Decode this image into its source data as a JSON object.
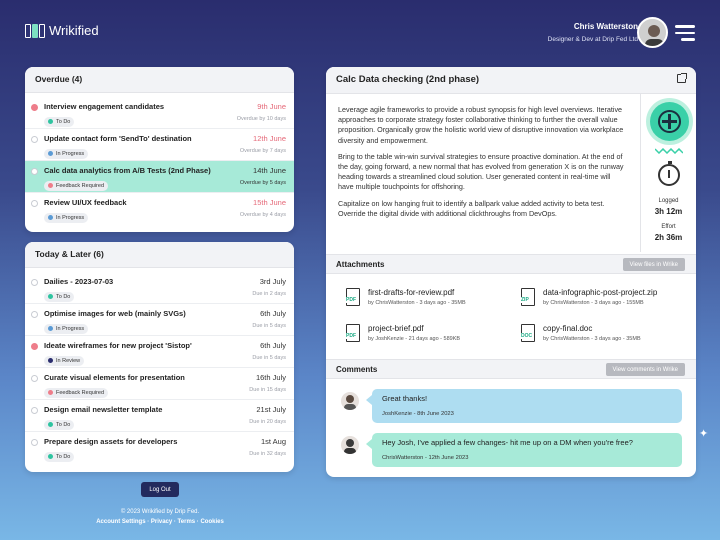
{
  "brand": {
    "name": "Wrikified"
  },
  "user": {
    "name": "Chris Watterston",
    "role": "Designer & Dev at Drip Fed Ltd"
  },
  "overdue": {
    "title": "Overdue (4)",
    "tasks": [
      {
        "title": "Interview engagement candidates",
        "status": "To Do",
        "status_color": "#2ec4a0",
        "date": "9th June",
        "sub": "Overdue by 10 days",
        "flag": "red"
      },
      {
        "title": "Update contact form 'SendTo' destination",
        "status": "In Progress",
        "status_color": "#5b9bd5",
        "date": "12th June",
        "sub": "Overdue by 7 days"
      },
      {
        "title": "Calc data analytics from A/B Tests (2nd Phase)",
        "status": "Feedback Required",
        "status_color": "#ee7d8a",
        "date": "14th June",
        "sub": "Overdue by 5 days"
      },
      {
        "title": "Review UI/UX feedback",
        "status": "In Progress",
        "status_color": "#5b9bd5",
        "date": "15th June",
        "sub": "Overdue by 4 days"
      }
    ]
  },
  "today": {
    "title": "Today & Later (6)",
    "tasks": [
      {
        "title": "Dailies - 2023-07-03",
        "status": "To Do",
        "status_color": "#2ec4a0",
        "date": "3rd July",
        "sub": "Due in 2 days"
      },
      {
        "title": "Optimise images for web (mainly SVGs)",
        "status": "In Progress",
        "status_color": "#5b9bd5",
        "date": "6th July",
        "sub": "Due in 5 days"
      },
      {
        "title": "Ideate wireframes for new project 'Sistop'",
        "status": "In Review",
        "status_color": "#2a2d6e",
        "date": "6th July",
        "sub": "Due in 5 days",
        "flag": "red"
      },
      {
        "title": "Curate visual elements for presentation",
        "status": "Feedback Required",
        "status_color": "#ee7d8a",
        "date": "16th July",
        "sub": "Due in 15 days"
      },
      {
        "title": "Design email newsletter template",
        "status": "To Do",
        "status_color": "#2ec4a0",
        "date": "21st July",
        "sub": "Due in 20 days"
      },
      {
        "title": "Prepare design assets for developers",
        "status": "To Do",
        "status_color": "#2ec4a0",
        "date": "1st Aug",
        "sub": "Due in 32 days"
      }
    ]
  },
  "logout_label": "Log Out",
  "footer": {
    "copyright": "© 2023 Wrikified by Drip Fed.",
    "links": "Account Settings · Privacy · Terms · Cookies"
  },
  "detail": {
    "title": "Calc Data checking (2nd phase)",
    "paragraphs": [
      "Leverage agile frameworks to provide a robust synopsis for high level overviews. Iterative approaches to corporate strategy foster collaborative thinking to further the overall value proposition. Organically grow the holistic world view of disruptive innovation via workplace diversity and empowerment.",
      "Bring to the table win-win survival strategies to ensure proactive domination. At the end of the day, going forward, a new normal that has evolved from generation X is on the runway heading towards a streamlined cloud solution. User generated content in real-time will have multiple touchpoints for offshoring.",
      "Capitalize on low hanging fruit to identify a ballpark value added activity to beta test. Override the digital divide with additional clickthroughs from DevOps."
    ],
    "logged_label": "Logged",
    "logged_value": "3h 12m",
    "effort_label": "Effort",
    "effort_value": "2h 36m",
    "attachments_title": "Attachments",
    "attachments_button": "View files in Wrike",
    "files": [
      {
        "name": "first-drafts-for-review.pdf",
        "meta": "by ChrisWatterston - 3 days ago - 35MB",
        "ext": "PDF"
      },
      {
        "name": "data-infographic-post-project.zip",
        "meta": "by ChrisWatterston - 3 days ago - 155MB",
        "ext": "ZIP"
      },
      {
        "name": "project-brief.pdf",
        "meta": "by JoshKenzie - 21 days ago - 589KB",
        "ext": "PDF"
      },
      {
        "name": "copy-final.doc",
        "meta": "by ChrisWatterston - 3 days ago - 35MB",
        "ext": "DOC"
      }
    ],
    "comments_title": "Comments",
    "comments_button": "View comments in Wrike",
    "comments": [
      {
        "text": "Great thanks!",
        "author": "JoshKenzie - 8th June 2023"
      },
      {
        "text": "Hey Josh, I've applied a few changes- hit me up on a DM when you're free?",
        "author": "ChrisWatterston - 12th June 2023"
      }
    ]
  }
}
